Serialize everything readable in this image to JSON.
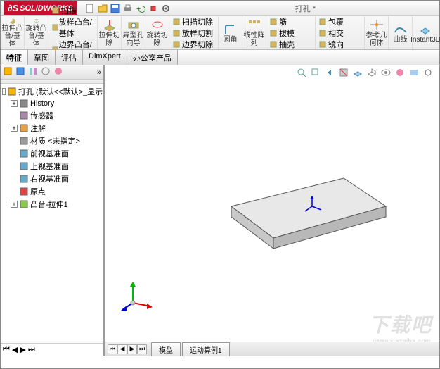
{
  "app": {
    "brand": "SOLIDWORKS",
    "doc_title": "打孔 *"
  },
  "ribbon": [
    {
      "label": "拉伸凸\n台/基\n体",
      "icon": "extrude"
    },
    {
      "label": "旋转凸\n台/基\n体",
      "icon": "revolve"
    },
    {
      "label": "扫描\n放样凸台/基体\n边界凸台/基体",
      "icon": "sweep-group",
      "stack": true
    },
    {
      "label": "拉伸切\n除",
      "icon": "cut-extrude"
    },
    {
      "label": "异型孔\n向导",
      "icon": "hole"
    },
    {
      "label": "旋转切\n除",
      "icon": "cut-revolve"
    },
    {
      "label": "扫描切除\n放样切割\n边界切除",
      "icon": "cut-sweep-group",
      "stack": true
    },
    {
      "label": "圆角",
      "icon": "fillet"
    },
    {
      "label": "线性阵\n列",
      "icon": "pattern"
    },
    {
      "label": "筋\n拔模\n抽壳",
      "icon": "rib-group",
      "stack": true
    },
    {
      "label": "包覆\n相交\n镜向",
      "icon": "wrap-group",
      "stack": true
    },
    {
      "label": "参考几\n何体",
      "icon": "ref-geom"
    },
    {
      "label": "曲线",
      "icon": "curves"
    },
    {
      "label": "Instant3D",
      "icon": "instant3d"
    }
  ],
  "tabs": [
    "特征",
    "草图",
    "评估",
    "DimXpert",
    "办公室产品"
  ],
  "active_tab": 0,
  "tree": [
    {
      "exp": "-",
      "icon": "part",
      "label": "打孔 (默认<<默认>_显示状态"
    },
    {
      "exp": "+",
      "icon": "history",
      "label": "History",
      "indent": 1
    },
    {
      "exp": "",
      "icon": "sensor",
      "label": "传感器",
      "indent": 1
    },
    {
      "exp": "+",
      "icon": "annot",
      "label": "注解",
      "indent": 1
    },
    {
      "exp": "",
      "icon": "material",
      "label": "材质 <未指定>",
      "indent": 1
    },
    {
      "exp": "",
      "icon": "plane",
      "label": "前视基准面",
      "indent": 1
    },
    {
      "exp": "",
      "icon": "plane",
      "label": "上视基准面",
      "indent": 1
    },
    {
      "exp": "",
      "icon": "plane",
      "label": "右视基准面",
      "indent": 1
    },
    {
      "exp": "",
      "icon": "origin",
      "label": "原点",
      "indent": 1
    },
    {
      "exp": "+",
      "icon": "feature",
      "label": "凸台-拉伸1",
      "indent": 1
    }
  ],
  "bottom_tabs": [
    "模型",
    "运动算例1"
  ],
  "watermark": "下载吧",
  "watermark_sub": "www.xiazaiba.com"
}
